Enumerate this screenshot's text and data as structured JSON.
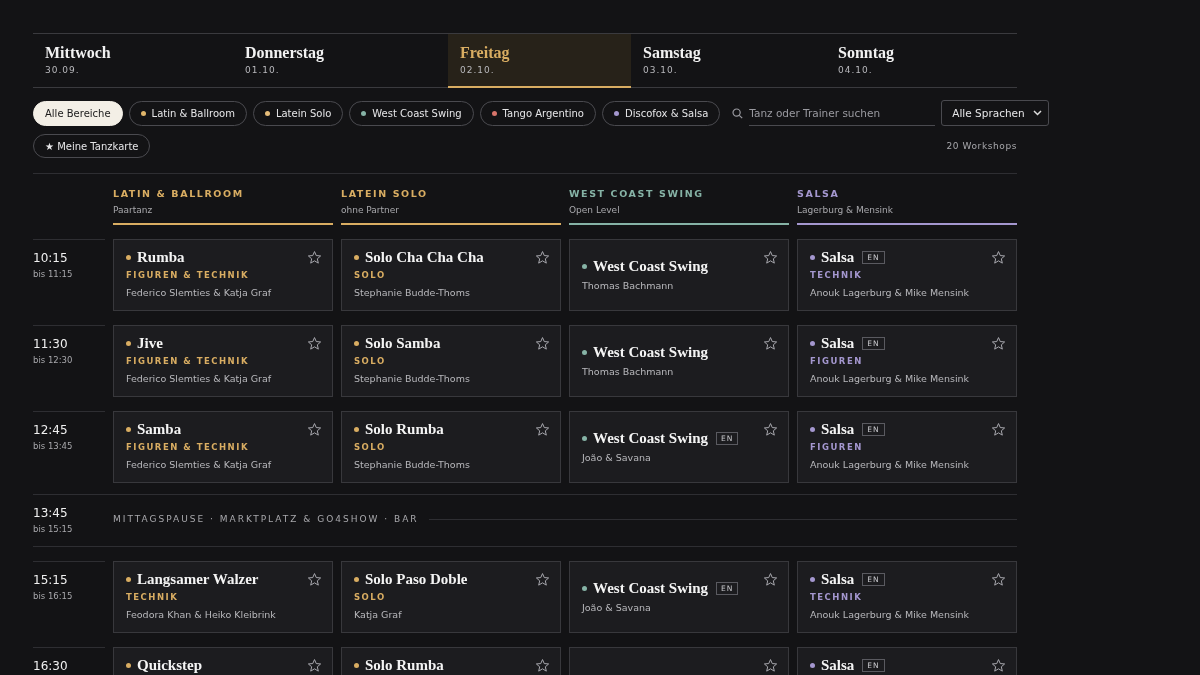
{
  "days": [
    {
      "name": "Mittwoch",
      "date": "30.09.",
      "selected": false
    },
    {
      "name": "Donnerstag",
      "date": "01.10.",
      "selected": false
    },
    {
      "name": "Freitag",
      "date": "02.10.",
      "selected": true
    },
    {
      "name": "Samstag",
      "date": "03.10.",
      "selected": false
    },
    {
      "name": "Sonntag",
      "date": "04.10.",
      "selected": false
    }
  ],
  "filters": [
    {
      "label": "Alle Bereiche",
      "selected": true
    },
    {
      "label": "Latin & Ballroom",
      "selected": false,
      "color": "#e0b56a"
    },
    {
      "label": "Latein Solo",
      "selected": false,
      "color": "#e6bd7a"
    },
    {
      "label": "West Coast Swing",
      "selected": false,
      "color": "#86b3a6"
    },
    {
      "label": "Tango Argentino",
      "selected": false,
      "color": "#d9756b"
    },
    {
      "label": "Discofox & Salsa",
      "selected": false,
      "color": "#a497cf"
    }
  ],
  "search": {
    "placeholder": "Tanz oder Trainer suchen"
  },
  "language_select": {
    "value": "Alle Sprachen"
  },
  "favorites_button": {
    "icon": "★",
    "label": "Meine Tanzkarte",
    "selected": false
  },
  "count": "20 Workshops",
  "columns": [
    {
      "title": "LATIN & BALLROOM",
      "subtitle": "Paartanz",
      "color": "#d9ad62"
    },
    {
      "title": "LATEIN SOLO",
      "subtitle": "ohne Partner",
      "color": "#d9ad62"
    },
    {
      "title": "WEST COAST SWING",
      "subtitle": "Open Level",
      "color": "#86b3a6"
    },
    {
      "title": "SALSA",
      "subtitle": "Lagerburg & Mensink",
      "color": "#a497cf"
    }
  ],
  "slots": [
    {
      "kind": "workshops",
      "time": "10:15",
      "until": "bis 11:15",
      "cards": [
        {
          "title": "Rumba",
          "category": "FIGUREN & TECHNIK",
          "trainer": "Federico Slemties & Katja Graf",
          "starred": false
        },
        {
          "title": "Solo Cha Cha Cha",
          "category": "SOLO",
          "trainer": "Stephanie Budde-Thoms",
          "starred": false
        },
        {
          "title": "West Coast Swing",
          "trainer": "Thomas Bachmann",
          "starred": false
        },
        {
          "title": "Salsa",
          "badge": "EN",
          "category": "TECHNIK",
          "trainer": "Anouk Lagerburg & Mike Mensink",
          "starred": false
        }
      ]
    },
    {
      "kind": "workshops",
      "time": "11:30",
      "until": "bis 12:30",
      "cards": [
        {
          "title": "Jive",
          "category": "FIGUREN & TECHNIK",
          "trainer": "Federico Slemties & Katja Graf",
          "starred": false
        },
        {
          "title": "Solo Samba",
          "category": "SOLO",
          "trainer": "Stephanie Budde-Thoms",
          "starred": false
        },
        {
          "title": "West Coast Swing",
          "trainer": "Thomas Bachmann",
          "starred": false
        },
        {
          "title": "Salsa",
          "badge": "EN",
          "category": "FIGUREN",
          "trainer": "Anouk Lagerburg & Mike Mensink",
          "starred": false
        }
      ]
    },
    {
      "kind": "workshops",
      "time": "12:45",
      "until": "bis 13:45",
      "cards": [
        {
          "title": "Samba",
          "category": "FIGUREN & TECHNIK",
          "trainer": "Federico Slemties & Katja Graf",
          "starred": false
        },
        {
          "title": "Solo Rumba",
          "category": "SOLO",
          "trainer": "Stephanie Budde-Thoms",
          "starred": false
        },
        {
          "title": "West Coast Swing",
          "badge": "EN",
          "trainer": "João & Savana",
          "starred": false
        },
        {
          "title": "Salsa",
          "badge": "EN",
          "category": "FIGUREN",
          "trainer": "Anouk Lagerburg & Mike Mensink",
          "starred": false
        }
      ]
    },
    {
      "kind": "break",
      "time": "13:45",
      "until": "bis 15:15",
      "label": "MITTAGSPAUSE · MARKTPLATZ & GO4SHOW · BAR"
    },
    {
      "kind": "workshops",
      "time": "15:15",
      "until": "bis 16:15",
      "cards": [
        {
          "title": "Langsamer Walzer",
          "category": "TECHNIK",
          "trainer": "Feodora Khan & Heiko Kleibrink",
          "starred": false
        },
        {
          "title": "Solo Paso Doble",
          "category": "SOLO",
          "trainer": "Katja Graf",
          "starred": false
        },
        {
          "title": "West Coast Swing",
          "badge": "EN",
          "trainer": "João & Savana",
          "starred": false
        },
        {
          "title": "Salsa",
          "badge": "EN",
          "category": "TECHNIK",
          "trainer": "Anouk Lagerburg & Mike Mensink",
          "starred": false
        }
      ]
    },
    {
      "kind": "workshops",
      "time": "16:30",
      "cards": [
        {
          "title": "Quickstep",
          "starred": false
        },
        {
          "title": "Solo Rumba",
          "starred": false
        },
        {
          "starred": false
        },
        {
          "title": "Salsa",
          "badge": "EN",
          "starred": false
        }
      ]
    }
  ]
}
